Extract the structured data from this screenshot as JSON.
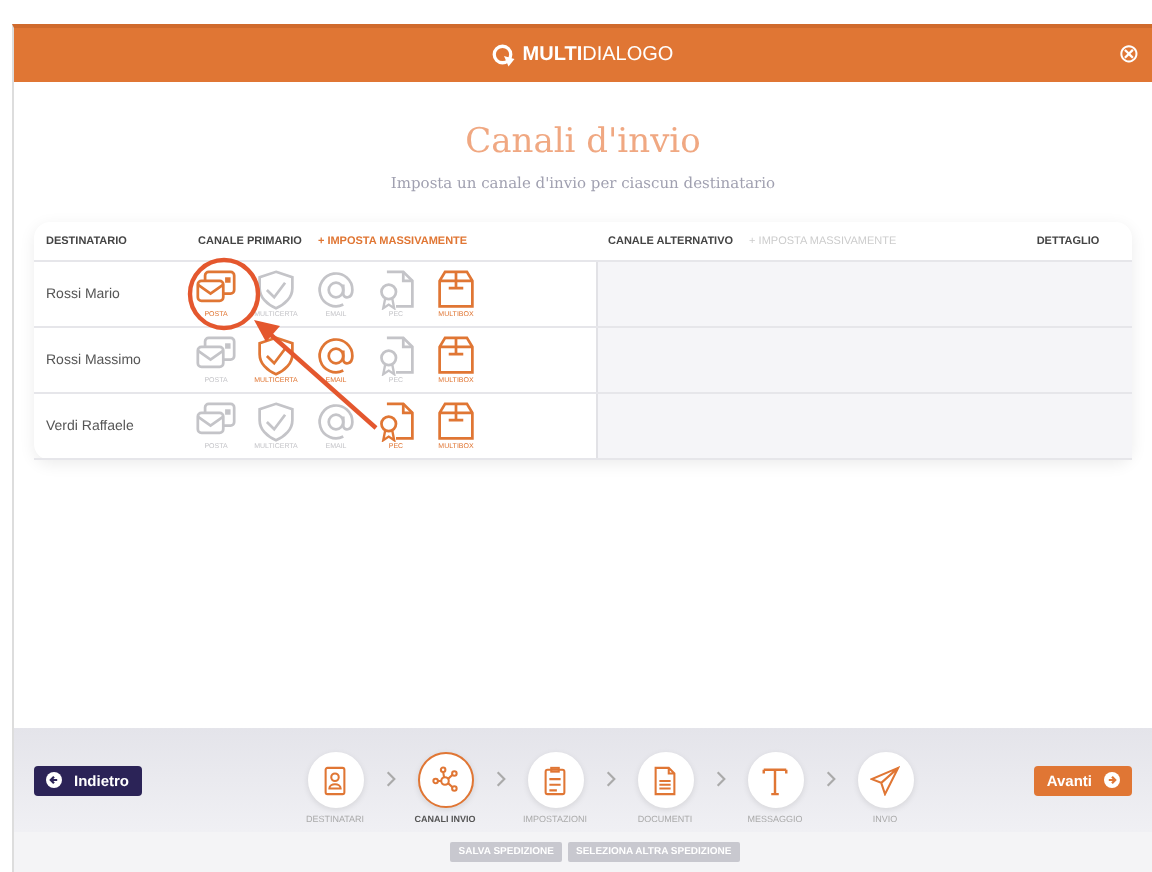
{
  "header": {
    "logo_bold": "MULTI",
    "logo_light": "DIALOGO",
    "close": "⊗"
  },
  "title": "Canali d'invio",
  "subtitle": "Imposta un canale d'invio per ciascun destinatario",
  "table": {
    "columns": [
      {
        "kind": "name",
        "label": "DESTINATARIO"
      },
      {
        "kind": "primary",
        "label": "CANALE PRIMARIO",
        "action": "+ IMPOSTA MASSIVAMENTE",
        "action_disabled": false
      },
      {
        "kind": "alt",
        "label": "CANALE ALTERNATIVO",
        "action": "+ IMPOSTA MASSIVAMENTE",
        "action_disabled": true
      },
      {
        "kind": "detail",
        "label": "DETTAGLIO"
      }
    ],
    "rows": [
      {
        "name": "Rossi Mario",
        "highlighted": true,
        "channels": [
          {
            "kind": "posta",
            "label": "POSTA",
            "available": true
          },
          {
            "kind": "multicerta",
            "label": "MULTICERTA",
            "available": false
          },
          {
            "kind": "email",
            "label": "EMAIL",
            "available": false
          },
          {
            "kind": "pec",
            "label": "PEC",
            "available": false
          },
          {
            "kind": "multibox",
            "label": "MULTIBOX",
            "available": true
          }
        ]
      },
      {
        "name": "Rossi Massimo",
        "highlighted": false,
        "channels": [
          {
            "kind": "posta",
            "label": "POSTA",
            "available": false
          },
          {
            "kind": "multicerta",
            "label": "MULTICERTA",
            "available": true
          },
          {
            "kind": "email",
            "label": "EMAIL",
            "available": true
          },
          {
            "kind": "pec",
            "label": "PEC",
            "available": false
          },
          {
            "kind": "multibox",
            "label": "MULTIBOX",
            "available": true
          }
        ]
      },
      {
        "name": "Verdi Raffaele",
        "highlighted": false,
        "channels": [
          {
            "kind": "posta",
            "label": "POSTA",
            "available": false
          },
          {
            "kind": "multicerta",
            "label": "MULTICERTA",
            "available": false
          },
          {
            "kind": "email",
            "label": "EMAIL",
            "available": false
          },
          {
            "kind": "pec",
            "label": "PEC",
            "available": true
          },
          {
            "kind": "multibox",
            "label": "MULTIBOX",
            "available": true
          }
        ]
      }
    ]
  },
  "back_button": "Indietro",
  "next_button": "Avanti",
  "steps": [
    {
      "kind": "recipients",
      "label": "DESTINATARI",
      "selected": false
    },
    {
      "kind": "channels",
      "label": "CANALI INVIO",
      "selected": true
    },
    {
      "kind": "settings",
      "label": "IMPOSTAZIONI",
      "selected": false
    },
    {
      "kind": "documents",
      "label": "DOCUMENTI",
      "selected": false
    },
    {
      "kind": "message",
      "label": "MESSAGGIO",
      "selected": false
    },
    {
      "kind": "send",
      "label": "INVIO",
      "selected": false
    }
  ],
  "footer_buttons": [
    "SALVA SPEDIZIONE",
    "SELEZIONA ALTRA SPEDIZIONE"
  ]
}
